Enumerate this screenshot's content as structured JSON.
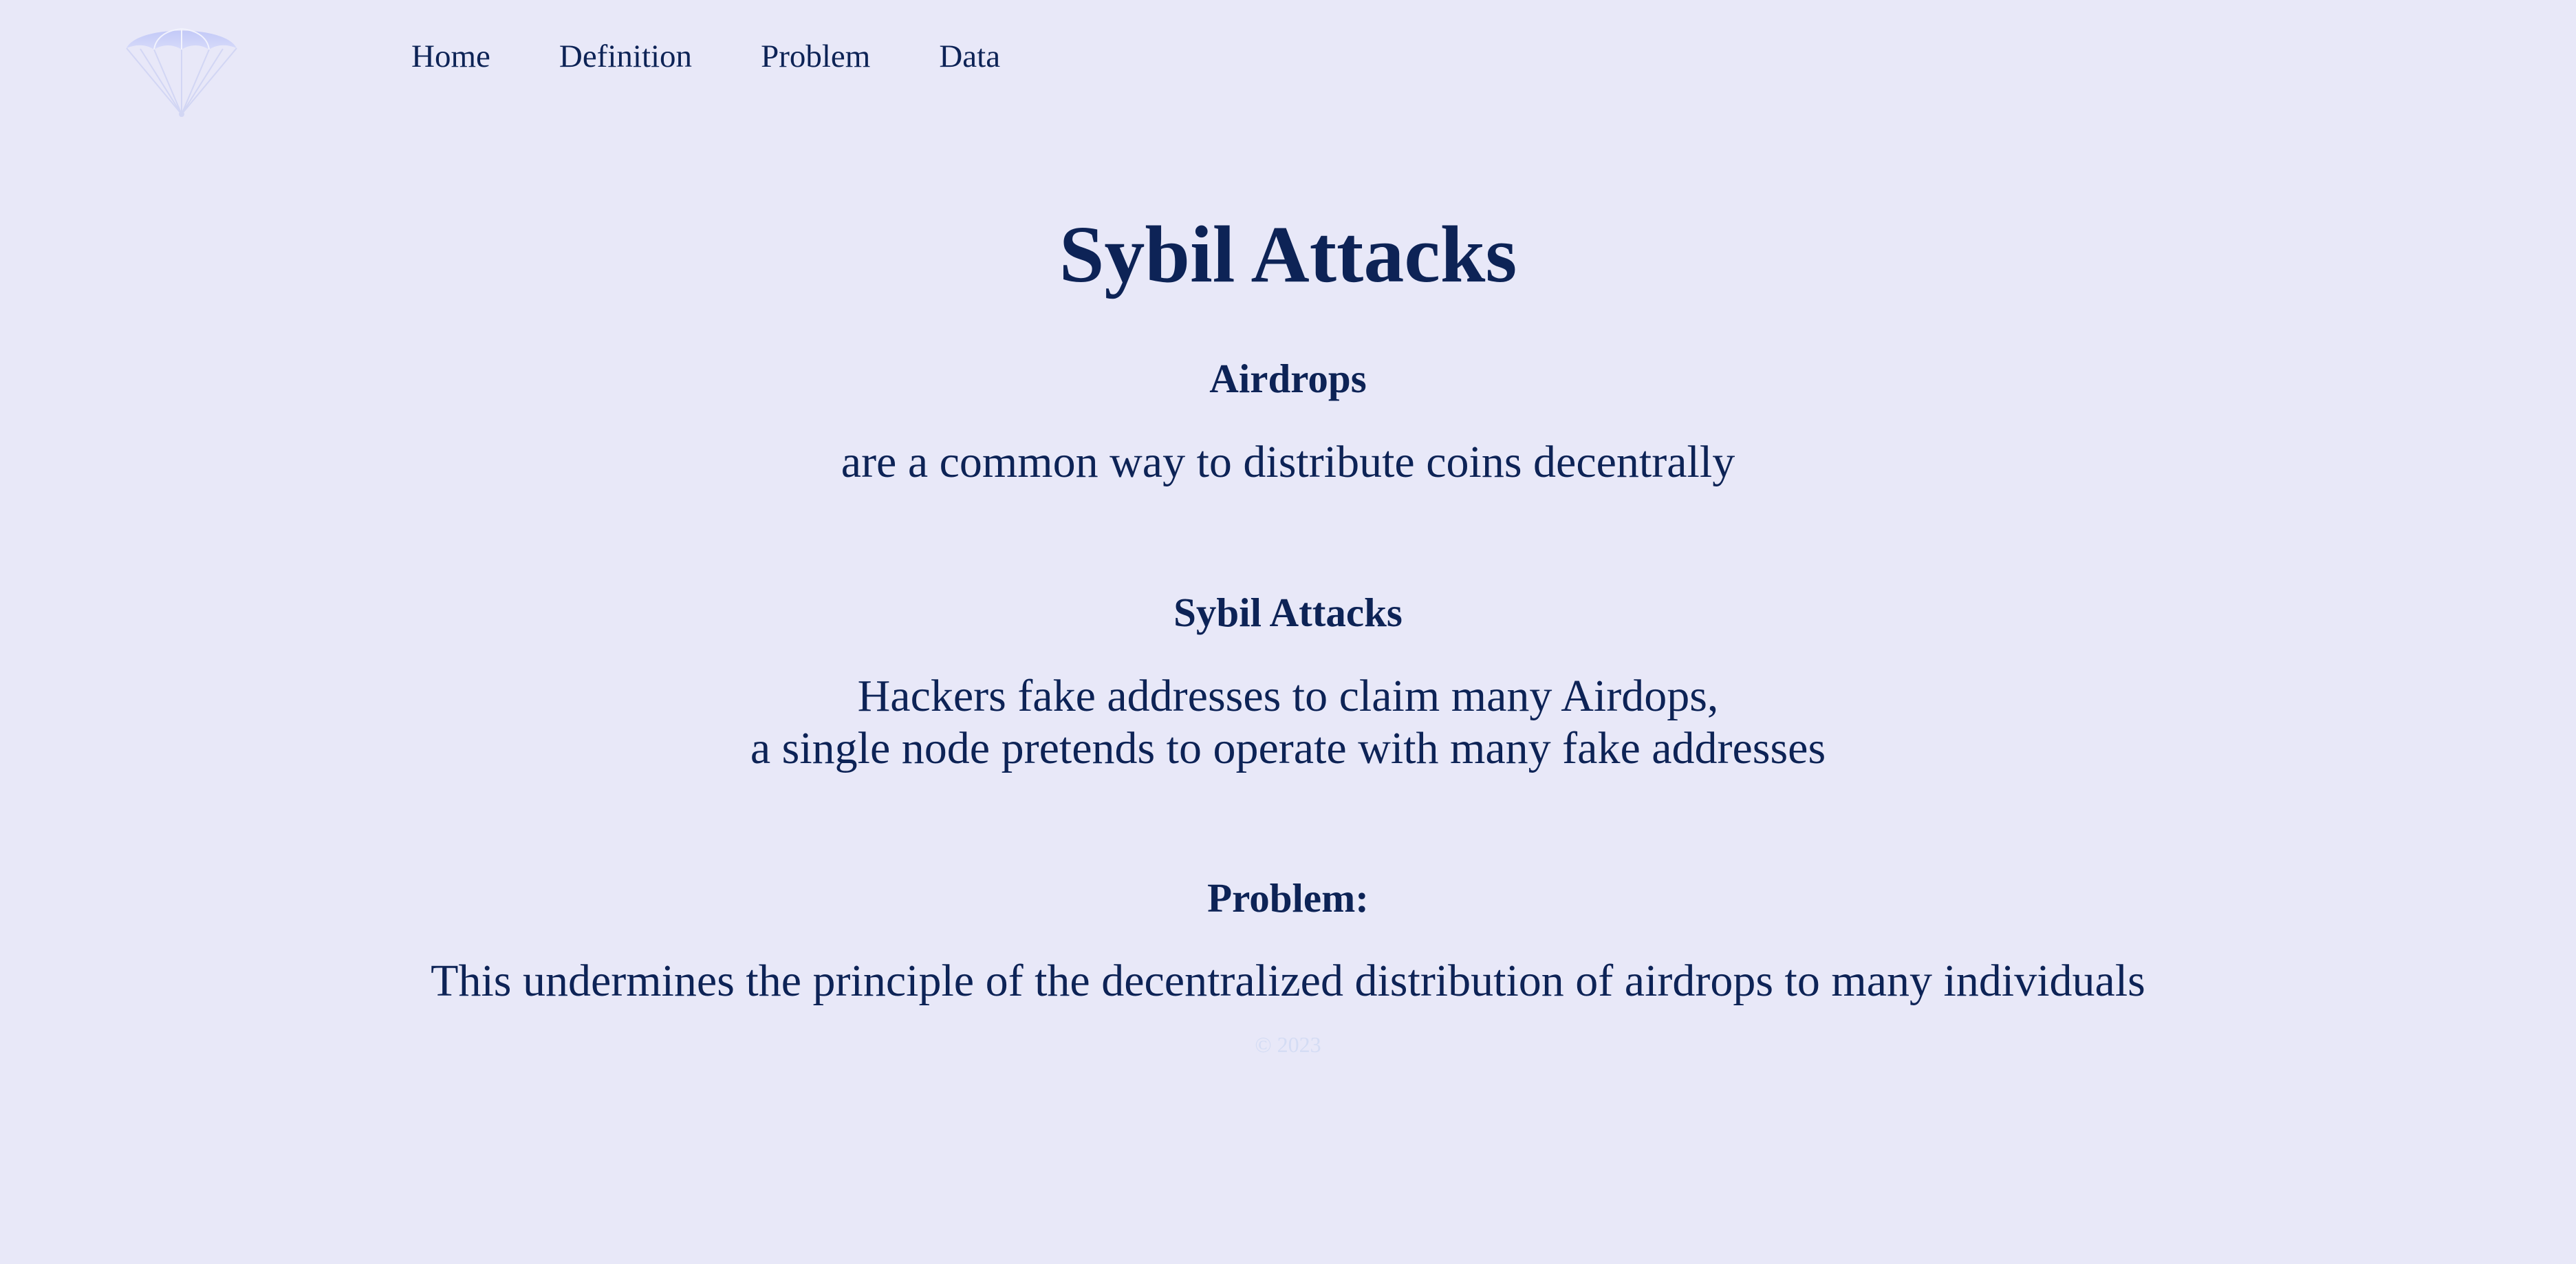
{
  "nav": {
    "items": [
      {
        "label": "Home"
      },
      {
        "label": "Definition"
      },
      {
        "label": "Problem"
      },
      {
        "label": "Data"
      }
    ]
  },
  "logo": {
    "icon": "parachute-icon",
    "color": "#c7ccf6"
  },
  "main": {
    "title": "Sybil Attacks",
    "sections": [
      {
        "heading": "Airdrops",
        "lines": [
          "are a common way to distribute coins decentrally"
        ]
      },
      {
        "heading": "Sybil Attacks",
        "lines": [
          "Hackers fake addresses to claim many Airdops,",
          "a single node pretends to operate with many fake addresses"
        ]
      },
      {
        "heading": "Problem:",
        "lines": [
          "This undermines the principle of the decentralized distribution of airdrops to many individuals"
        ]
      }
    ]
  },
  "footer": {
    "note": "© 2023"
  },
  "colors": {
    "background": "#e8e8f8",
    "text": "#0d2356"
  }
}
